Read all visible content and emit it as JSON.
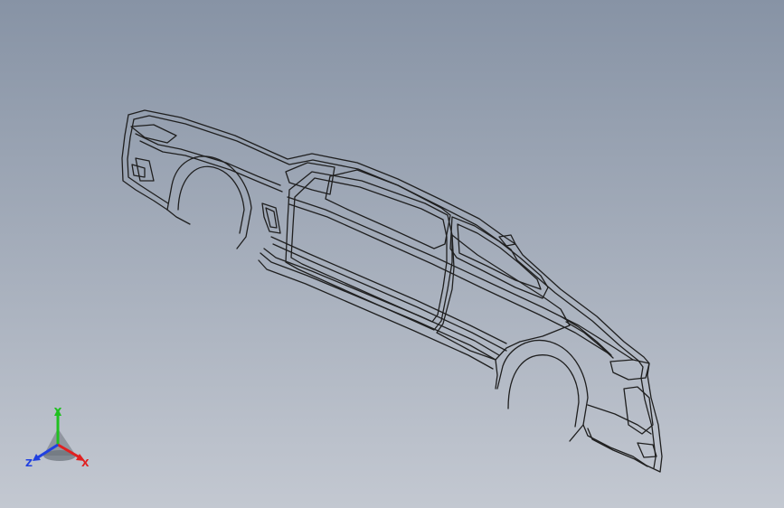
{
  "viewport": {
    "background_top": "#8793a5",
    "background_bottom": "#c3c8d1"
  },
  "model": {
    "icon": "car-body-wireframe",
    "stroke_color": "#1f1f1f",
    "fill_color": "#aeb7c4"
  },
  "triad": {
    "x_label": "X",
    "y_label": "Y",
    "z_label": "Z",
    "x_color": "#e02020",
    "y_color": "#20c020",
    "z_color": "#2040e0"
  }
}
